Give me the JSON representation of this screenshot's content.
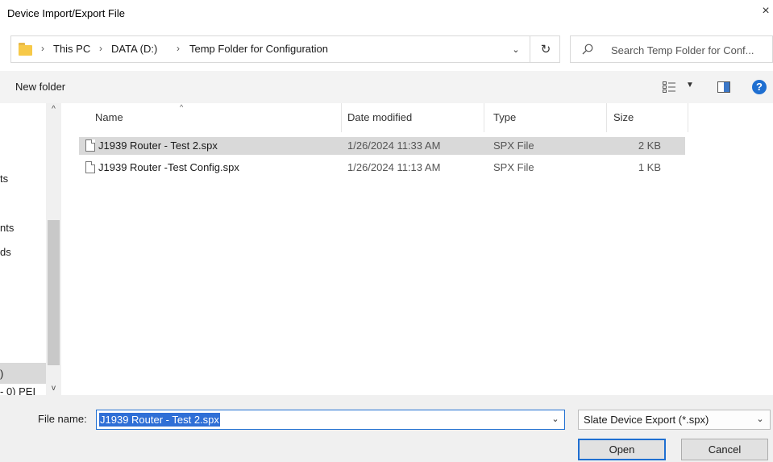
{
  "window": {
    "title": "Device Import/Export File",
    "close_glyph": "×"
  },
  "address": {
    "crumbs": [
      "This PC",
      "DATA (D:)",
      "Temp Folder for Configuration"
    ],
    "separator": "›",
    "dropdown_glyph": "⌄",
    "refresh_glyph": "↻"
  },
  "search": {
    "placeholder": "Search Temp Folder for Conf..."
  },
  "toolbar": {
    "new_folder": "New folder",
    "help": "?"
  },
  "nav": {
    "items": [
      "ts",
      "nts",
      "ds",
      ")",
      "- 0) PEI"
    ]
  },
  "columns": {
    "name": "Name",
    "date": "Date modified",
    "type": "Type",
    "size": "Size"
  },
  "files": [
    {
      "name": "J1939 Router - Test 2.spx",
      "date": "1/26/2024 11:33 AM",
      "type": "SPX File",
      "size": "2 KB",
      "selected": true
    },
    {
      "name": "J1939 Router -Test Config.spx",
      "date": "1/26/2024 11:13 AM",
      "type": "SPX File",
      "size": "1 KB",
      "selected": false
    }
  ],
  "bottom": {
    "file_name_label": "File name:",
    "file_name_value": "J1939 Router - Test 2.spx",
    "file_type": "Slate Device Export (*.spx)",
    "open_label": "Open",
    "cancel_label": "Cancel"
  },
  "colors": {
    "accent": "#1f6fd1",
    "selection": "#d9d9d9",
    "folder": "#f7c948"
  }
}
